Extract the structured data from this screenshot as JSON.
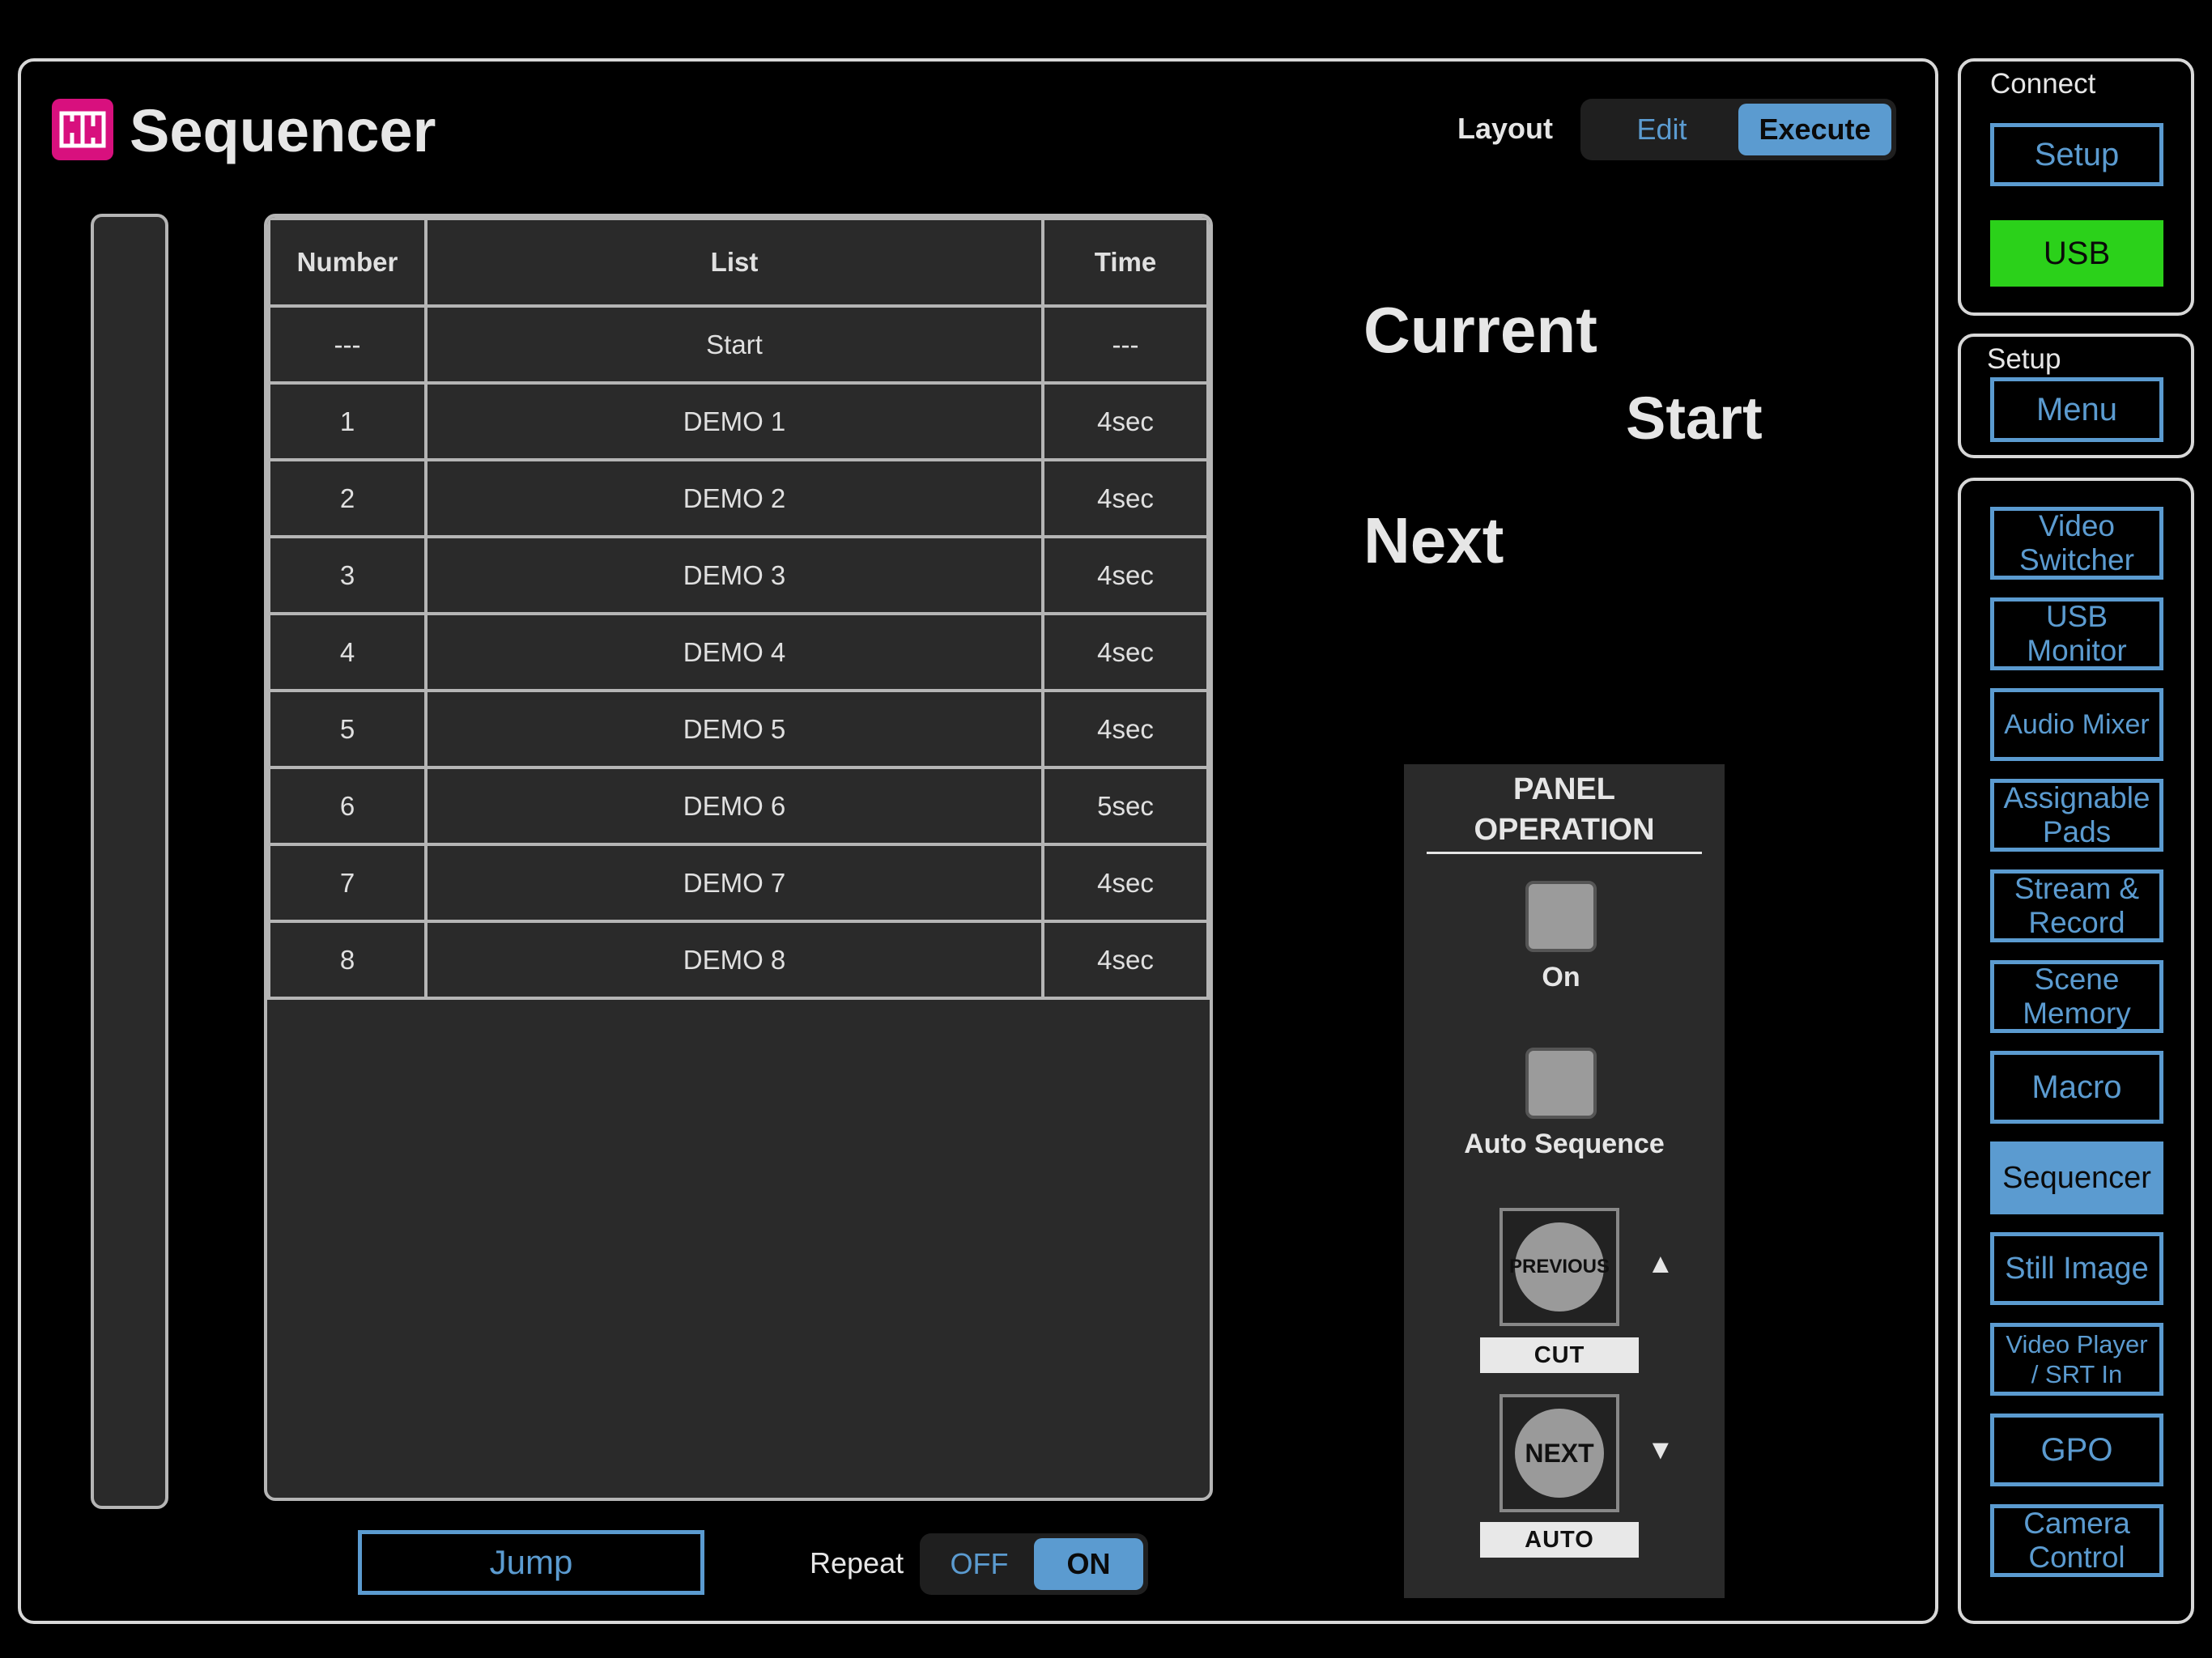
{
  "header": {
    "title": "Sequencer",
    "layout_label": "Layout",
    "layout_options": {
      "edit": "Edit",
      "execute": "Execute"
    }
  },
  "table": {
    "columns": {
      "number": "Number",
      "list": "List",
      "time": "Time"
    },
    "rows": [
      {
        "number": "---",
        "list": "Start",
        "time": "---"
      },
      {
        "number": "1",
        "list": "DEMO 1",
        "time": "4sec"
      },
      {
        "number": "2",
        "list": "DEMO 2",
        "time": "4sec"
      },
      {
        "number": "3",
        "list": "DEMO 3",
        "time": "4sec"
      },
      {
        "number": "4",
        "list": "DEMO 4",
        "time": "4sec"
      },
      {
        "number": "5",
        "list": "DEMO 5",
        "time": "4sec"
      },
      {
        "number": "6",
        "list": "DEMO 6",
        "time": "5sec"
      },
      {
        "number": "7",
        "list": "DEMO 7",
        "time": "4sec"
      },
      {
        "number": "8",
        "list": "DEMO 8",
        "time": "4sec"
      }
    ]
  },
  "status": {
    "current_label": "Current",
    "current_value": "Start",
    "next_label": "Next"
  },
  "controls": {
    "jump_label": "Jump",
    "repeat_label": "Repeat",
    "repeat_off": "OFF",
    "repeat_on": "ON"
  },
  "panel_operation": {
    "title_line1": "PANEL",
    "title_line2": "OPERATION",
    "on_label": "On",
    "auto_sequence_label": "Auto Sequence",
    "previous_key": "PREVIOUS",
    "cut_label": "CUT",
    "next_key": "NEXT",
    "auto_label": "AUTO",
    "up_arrow": "▲",
    "down_arrow": "▼"
  },
  "sidebar": {
    "connect_label": "Connect",
    "connect_setup": "Setup",
    "usb": "USB",
    "setup_label": "Setup",
    "menu": "Menu",
    "nav": [
      {
        "line1": "Video",
        "line2": "Switcher"
      },
      {
        "line1": "USB",
        "line2": "Monitor"
      },
      {
        "line1": "Audio Mixer",
        "line2": ""
      },
      {
        "line1": "Assignable",
        "line2": "Pads"
      },
      {
        "line1": "Stream &",
        "line2": "Record"
      },
      {
        "line1": "Scene",
        "line2": "Memory"
      },
      {
        "line1": "Macro",
        "line2": ""
      },
      {
        "line1": "Sequencer",
        "line2": ""
      },
      {
        "line1": "Still Image",
        "line2": ""
      },
      {
        "line1": "Video Player",
        "line2": "/ SRT In"
      },
      {
        "line1": "GPO",
        "line2": ""
      },
      {
        "line1": "Camera",
        "line2": "Control"
      }
    ]
  },
  "colors": {
    "accent": "#5b9bd0",
    "usb_green": "#2bd11a",
    "logo": "#d8107e"
  }
}
